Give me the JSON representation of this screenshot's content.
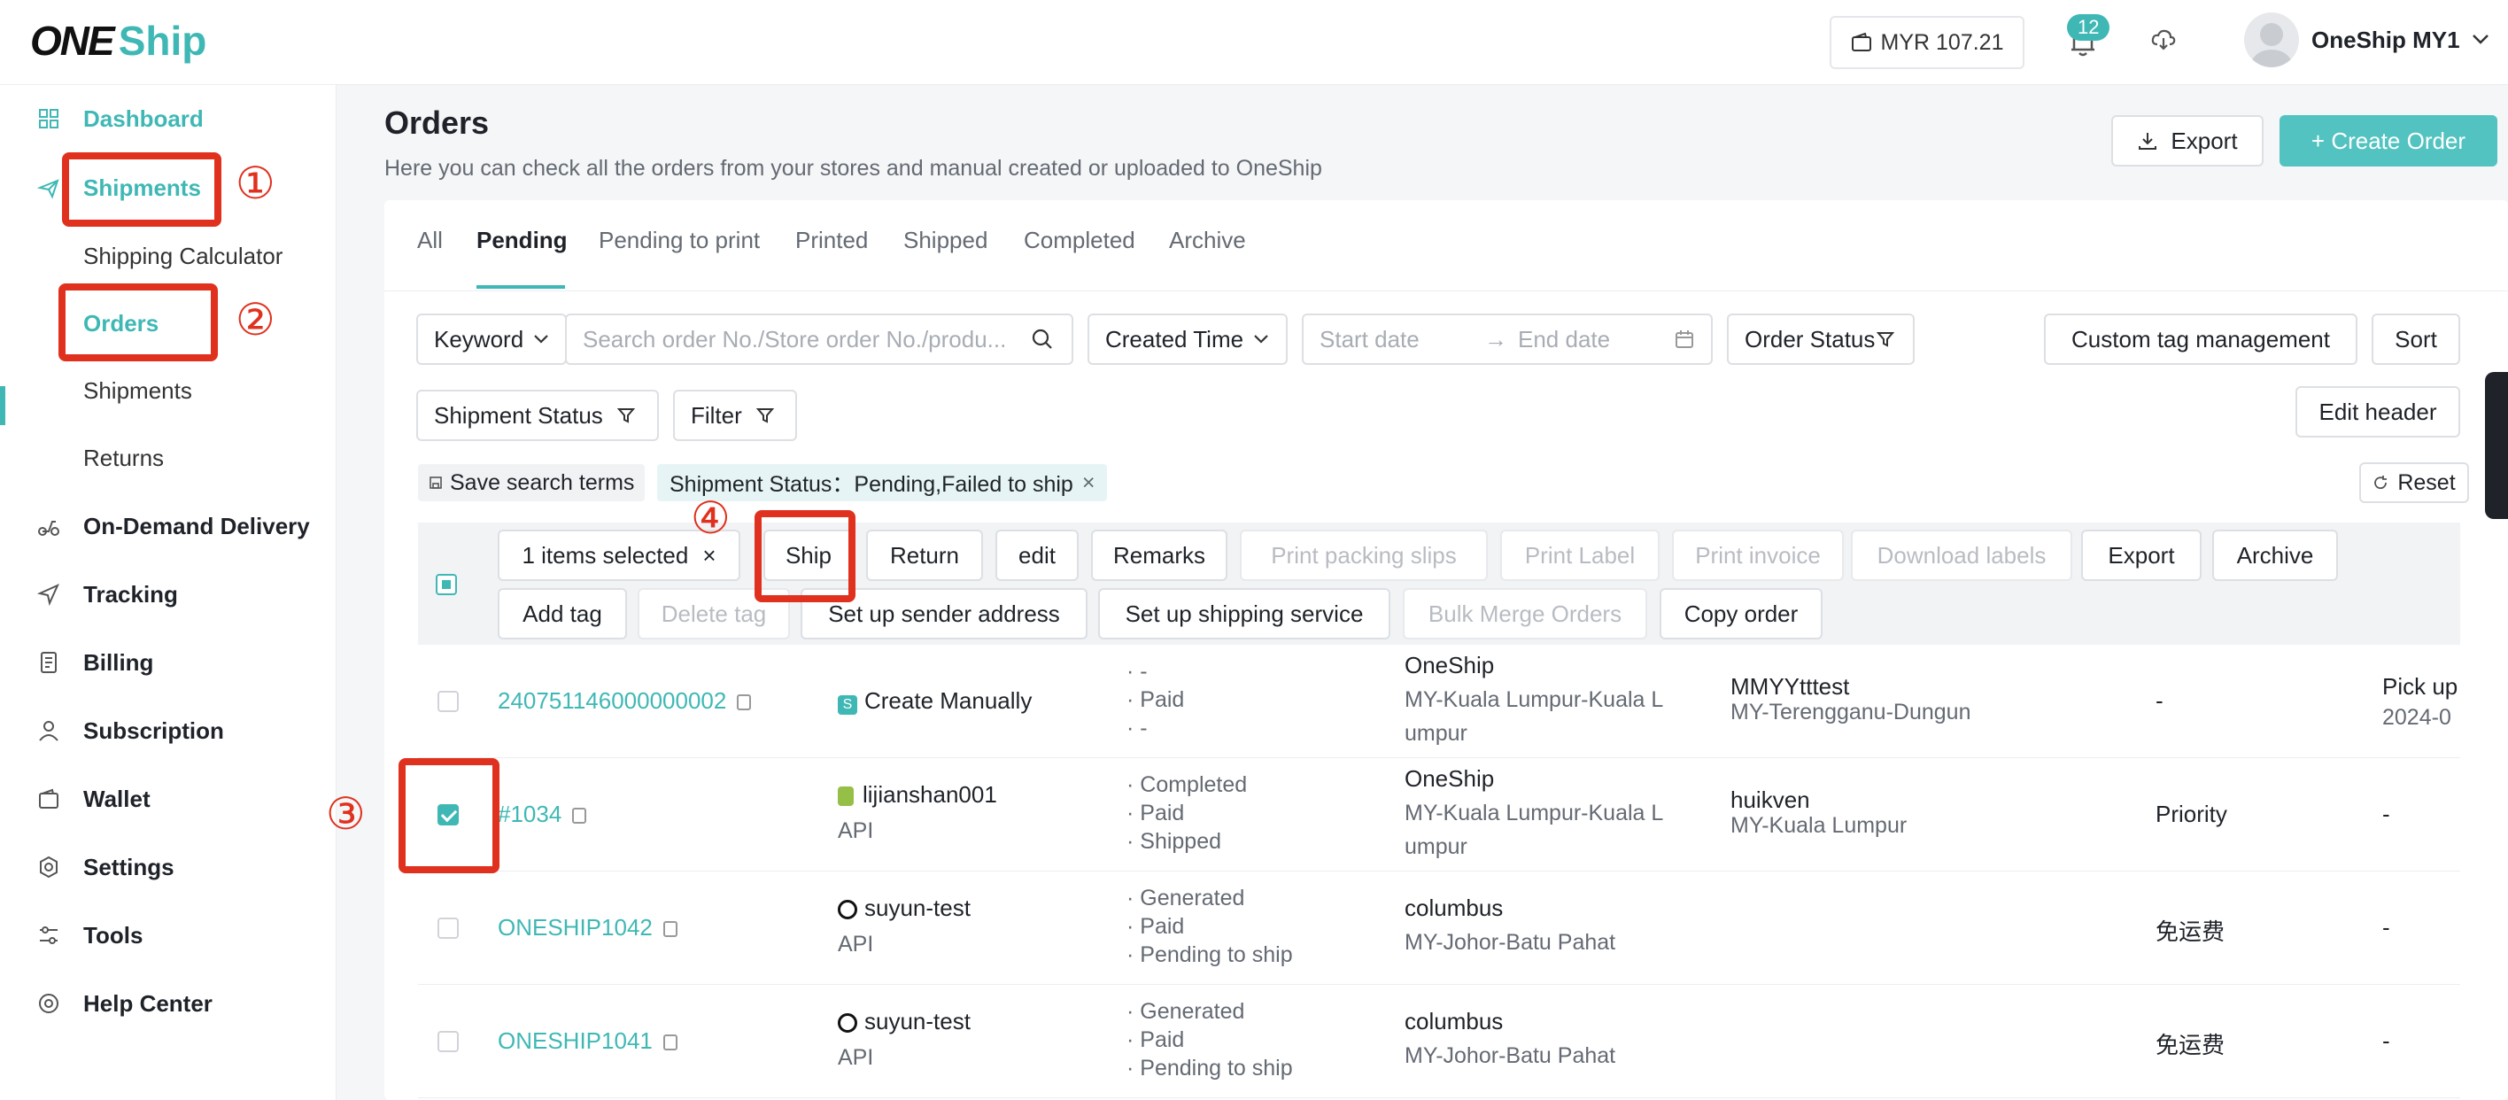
{
  "app": {
    "logo_one": "ONE",
    "logo_ship": "Ship"
  },
  "header": {
    "balance": "MYR 107.21",
    "notifications": "12",
    "user_name": "OneShip MY1"
  },
  "sidebar": {
    "items": [
      {
        "label": "Dashboard"
      },
      {
        "label": "Shipments"
      },
      {
        "label": "Shipping Calculator"
      },
      {
        "label": "Orders"
      },
      {
        "label": "Shipments"
      },
      {
        "label": "Returns"
      },
      {
        "label": "On-Demand Delivery"
      },
      {
        "label": "Tracking"
      },
      {
        "label": "Billing"
      },
      {
        "label": "Subscription"
      },
      {
        "label": "Wallet"
      },
      {
        "label": "Settings"
      },
      {
        "label": "Tools"
      },
      {
        "label": "Help Center"
      }
    ]
  },
  "annotations": {
    "a1": "①",
    "a2": "②",
    "a3": "③",
    "a4": "④"
  },
  "page": {
    "title": "Orders",
    "subtitle": "Here you can check all the orders from your stores and manual created or uploaded to OneShip",
    "export": "Export",
    "create_order": "+ Create Order"
  },
  "tabs": [
    "All",
    "Pending",
    "Pending to print",
    "Printed",
    "Shipped",
    "Completed",
    "Archive"
  ],
  "filters": {
    "keyword": "Keyword",
    "search_placeholder": "Search order No./Store order No./produ...",
    "created_time": "Created Time",
    "start_date": "Start date",
    "end_date": "End date",
    "order_status": "Order Status",
    "custom_tag": "Custom tag management",
    "sort": "Sort",
    "shipment_status": "Shipment Status",
    "filter": "Filter",
    "edit_header": "Edit header",
    "save_search": "Save search terms",
    "chip": "Shipment Status：Pending,Failed to ship",
    "reset": "Reset"
  },
  "bulk": {
    "selected": "1 items selected",
    "ship": "Ship",
    "return": "Return",
    "edit": "edit",
    "remarks": "Remarks",
    "print_packing": "Print packing slips",
    "print_label": "Print Label",
    "print_invoice": "Print invoice",
    "download_labels": "Download labels",
    "export": "Export",
    "archive": "Archive",
    "add_tag": "Add tag",
    "delete_tag": "Delete tag",
    "sender_address": "Set up sender address",
    "shipping_service": "Set up shipping service",
    "bulk_merge": "Bulk Merge Orders",
    "copy_order": "Copy order"
  },
  "rows": [
    {
      "order": "240751146000000002",
      "store": "Create Manually",
      "source": "",
      "s1": "· -",
      "s2": "· Paid",
      "s3": "· -",
      "sender": "OneShip",
      "sender_loc1": "MY-Kuala Lumpur-Kuala L",
      "sender_loc2": "umpur",
      "recv": "MMYYtttest",
      "recv_loc": "MY-Terengganu-Dungun",
      "service": "-",
      "pickup": "Pick up",
      "pickup_date": "2024-0"
    },
    {
      "order": "#1034",
      "store": "lijianshan001",
      "source": "API",
      "s1": "· Completed",
      "s2": "· Paid",
      "s3": "· Shipped",
      "sender": "OneShip",
      "sender_loc1": "MY-Kuala Lumpur-Kuala L",
      "sender_loc2": "umpur",
      "recv": "huikven",
      "recv_loc": "MY-Kuala Lumpur",
      "service": "Priority",
      "pickup": "-",
      "pickup_date": ""
    },
    {
      "order": "ONESHIP1042",
      "store": "suyun-test",
      "source": "API",
      "s1": "· Generated",
      "s2": "· Paid",
      "s3": "· Pending to ship",
      "sender": "columbus",
      "sender_loc1": "MY-Johor-Batu Pahat",
      "sender_loc2": "",
      "recv": "",
      "recv_loc": "",
      "service": "免运费",
      "pickup": "-",
      "pickup_date": ""
    },
    {
      "order": "ONESHIP1041",
      "store": "suyun-test",
      "source": "API",
      "s1": "· Generated",
      "s2": "· Paid",
      "s3": "· Pending to ship",
      "sender": "columbus",
      "sender_loc1": "MY-Johor-Batu Pahat",
      "sender_loc2": "",
      "recv": "",
      "recv_loc": "",
      "service": "免运费",
      "pickup": "-",
      "pickup_date": ""
    }
  ]
}
